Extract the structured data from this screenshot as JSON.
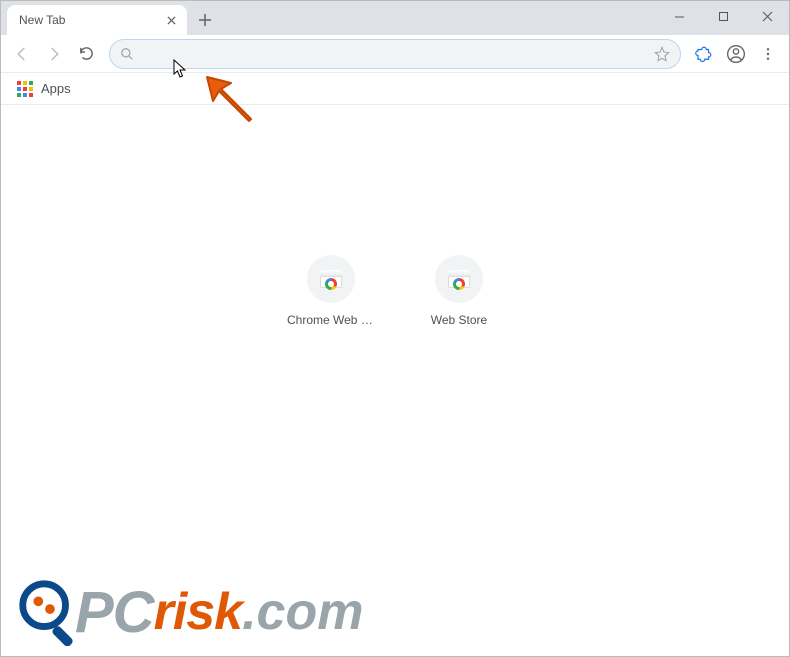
{
  "tab": {
    "title": "New Tab"
  },
  "bookmarks": {
    "apps_label": "Apps"
  },
  "omnibox": {
    "value": "",
    "placeholder": ""
  },
  "shortcuts": [
    {
      "label": "Chrome Web St..."
    },
    {
      "label": "Web Store"
    }
  ],
  "watermark": {
    "text1": "PC",
    "text2": "risk",
    "text3": ".com"
  }
}
